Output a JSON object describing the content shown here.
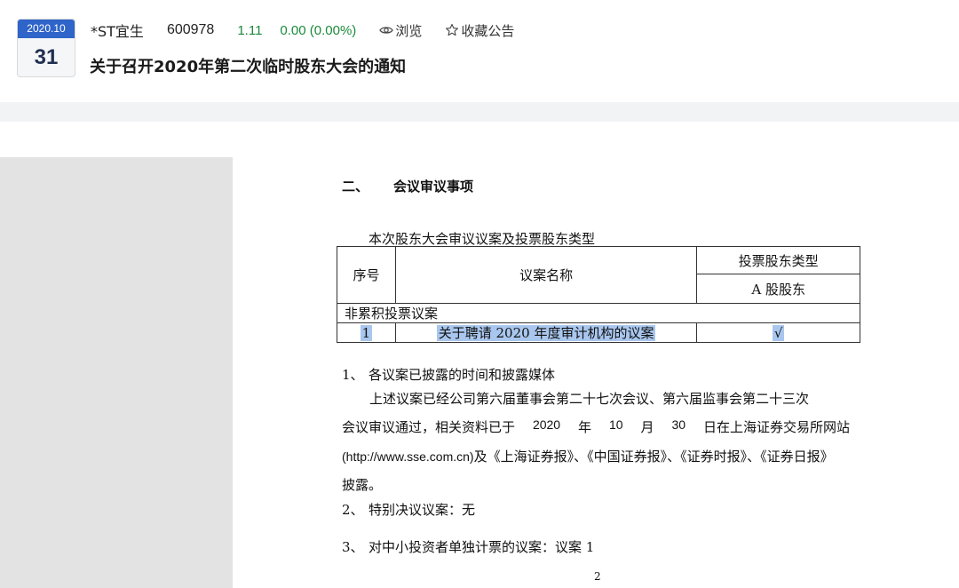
{
  "header": {
    "date_month": "2020.10",
    "date_day": "31",
    "stock_name": "*ST宜生",
    "stock_code": "600978",
    "price": "1.11",
    "change": "0.00 (0.00%)",
    "browse_label": "浏览",
    "favorite_label": "收藏公告",
    "title": "关于召开2020年第二次临时股东大会的通知",
    "colors": {
      "date_bar": "#2f64c8",
      "up_down_green": "#1a8a3a"
    }
  },
  "document": {
    "section_num": "二、",
    "section_title": "会议审议事项",
    "table_caption": "本次股东大会审议议案及投票股东类型",
    "table": {
      "col_no": "序号",
      "col_name": "议案名称",
      "col_vote_type": "投票股东类型",
      "col_vote_sub": "A 股股东",
      "group_label": "非累积投票议案",
      "rows": [
        {
          "no": "1",
          "name": "关于聘请 2020 年度审计机构的议案",
          "check": "√"
        }
      ]
    },
    "item1_num": "1、",
    "item1_title": "各议案已披露的时间和披露媒体",
    "item1_line1": "上述议案已经公司第六届董事会第二十七次会议、第六届监事会第二十三次",
    "item1_line2_words": [
      "会议审议通过，相关资料已于",
      "2020",
      "年",
      "10",
      "月",
      "30",
      "日在上海证券交易所网站"
    ],
    "item1_url": "(http://www.sse.com.cn)",
    "item1_line3_rest": "及《上海证券报》、《中国证券报》、《证券时报》、《证券日报》",
    "item1_line4": "披露。",
    "item2_num": "2、",
    "item2_text": "特别决议议案：无",
    "item3_num": "3、",
    "item3_text": "对中小投资者单独计票的议案：议案 1",
    "page_number": "2"
  }
}
